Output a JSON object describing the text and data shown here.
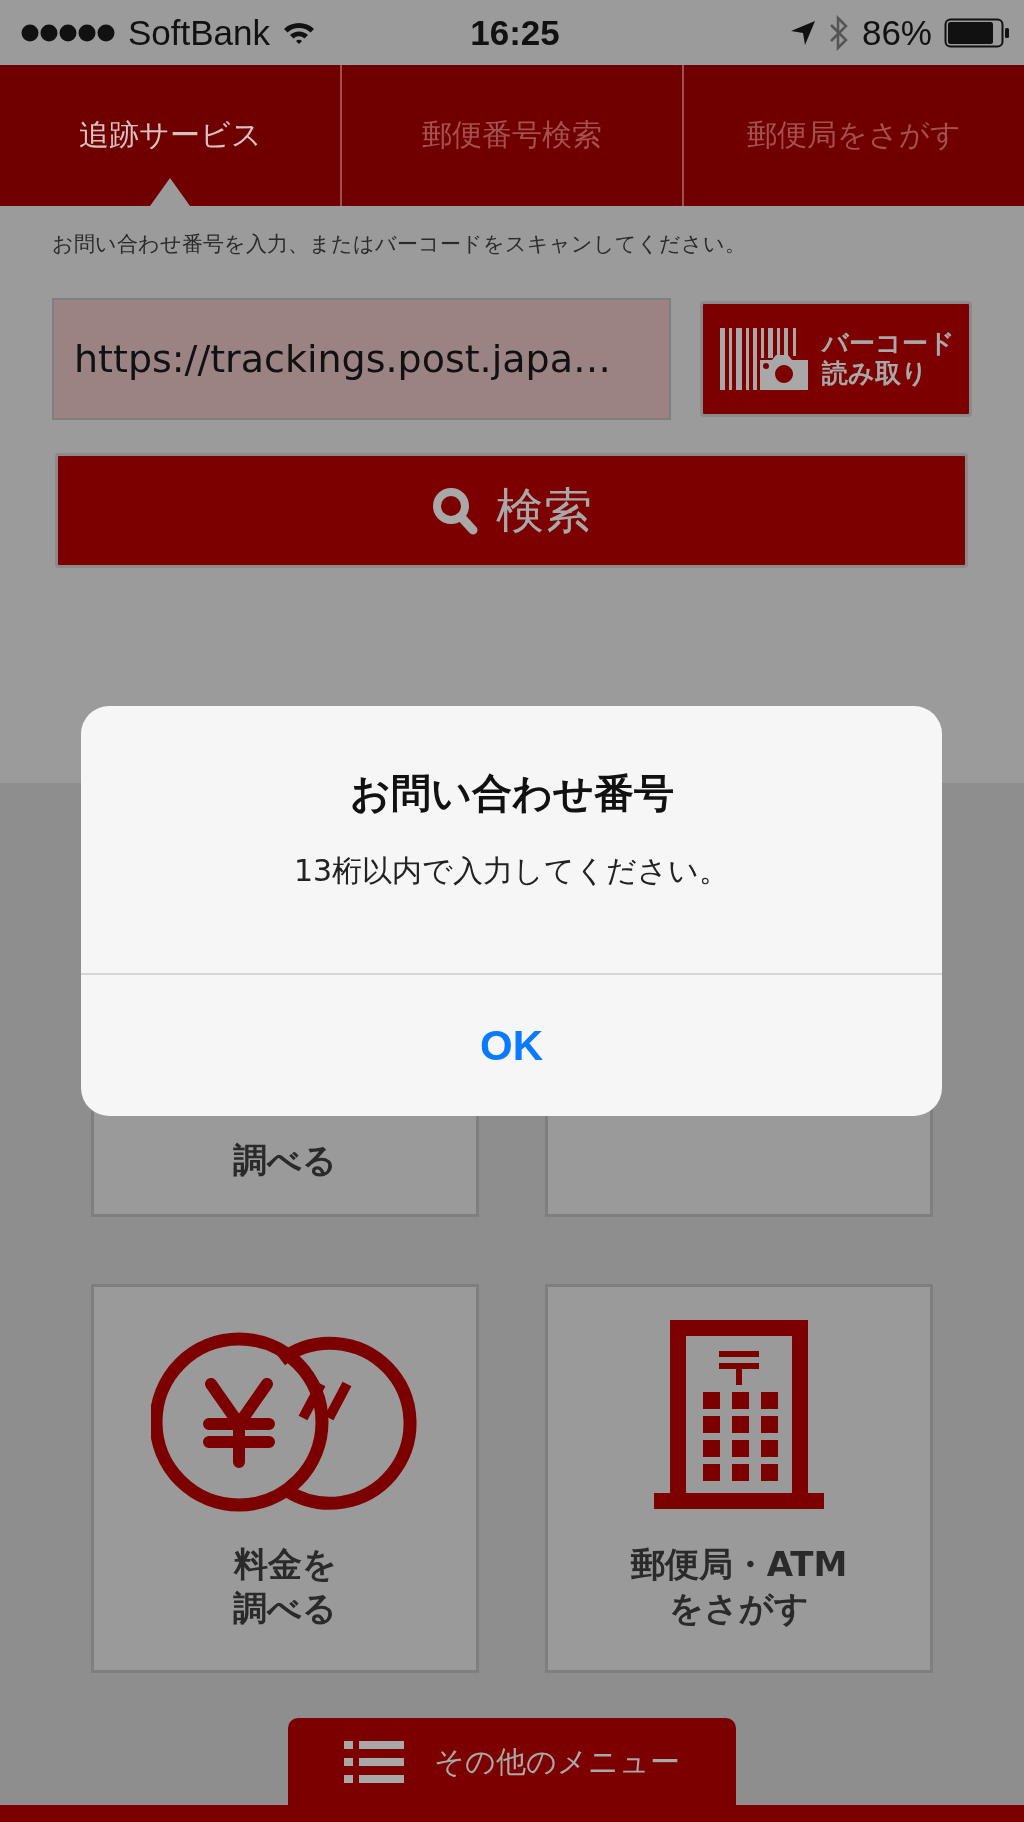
{
  "status_bar": {
    "carrier": "SoftBank",
    "time": "16:25",
    "battery": "86%"
  },
  "tabs": [
    {
      "label": "追跡サービス",
      "selected": true
    },
    {
      "label": "郵便番号検索",
      "selected": false
    },
    {
      "label": "郵便局をさがす",
      "selected": false
    }
  ],
  "tracking": {
    "hint": "お問い合わせ番号を入力、またはバーコードをスキャンしてください。",
    "field_value": "https://trackings.post.japa…",
    "barcode_button": [
      "バーコード",
      "読み取り"
    ],
    "search_button": "検索"
  },
  "menu_tiles": [
    {
      "kind": "text",
      "label_lines": [
        "調べる"
      ]
    },
    {
      "kind": "text"
    },
    {
      "kind": "coins",
      "label_lines": [
        "料金を",
        "調べる"
      ]
    },
    {
      "kind": "post-office",
      "label_lines": [
        "郵便局・ATM",
        "をさがす"
      ]
    }
  ],
  "more_menu": "その他のメニュー",
  "dialog": {
    "title": "お問い合わせ番号",
    "message": "13桁以内で入力してください。",
    "button": "OK"
  }
}
